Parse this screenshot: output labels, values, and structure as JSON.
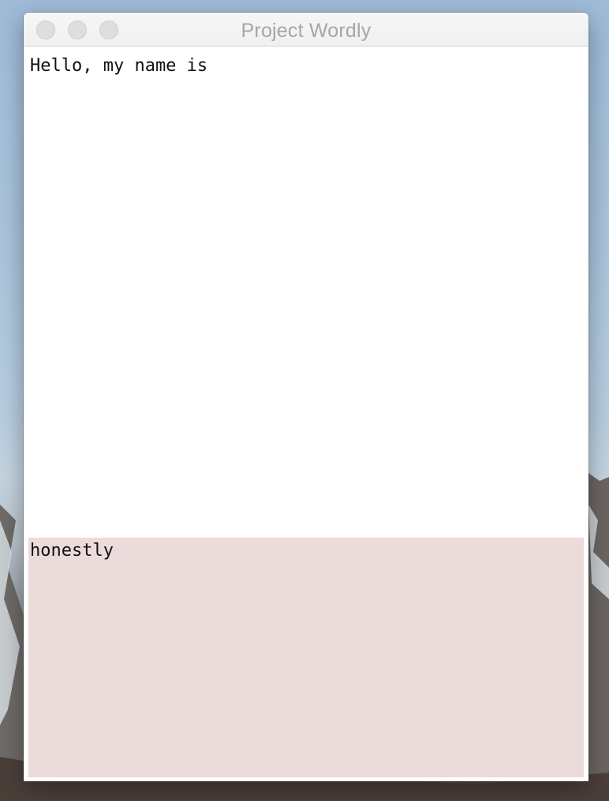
{
  "window": {
    "title": "Project Wordly"
  },
  "editor": {
    "text": "Hello, my name is"
  },
  "suggestion": {
    "text": "honestly"
  },
  "colors": {
    "suggestion_background": "#ebdbda",
    "editor_background": "#ffffff",
    "title_text": "#a6a6a6"
  },
  "icons": {
    "close": "close-button-icon",
    "minimize": "minimize-button-icon",
    "zoom": "zoom-button-icon"
  }
}
